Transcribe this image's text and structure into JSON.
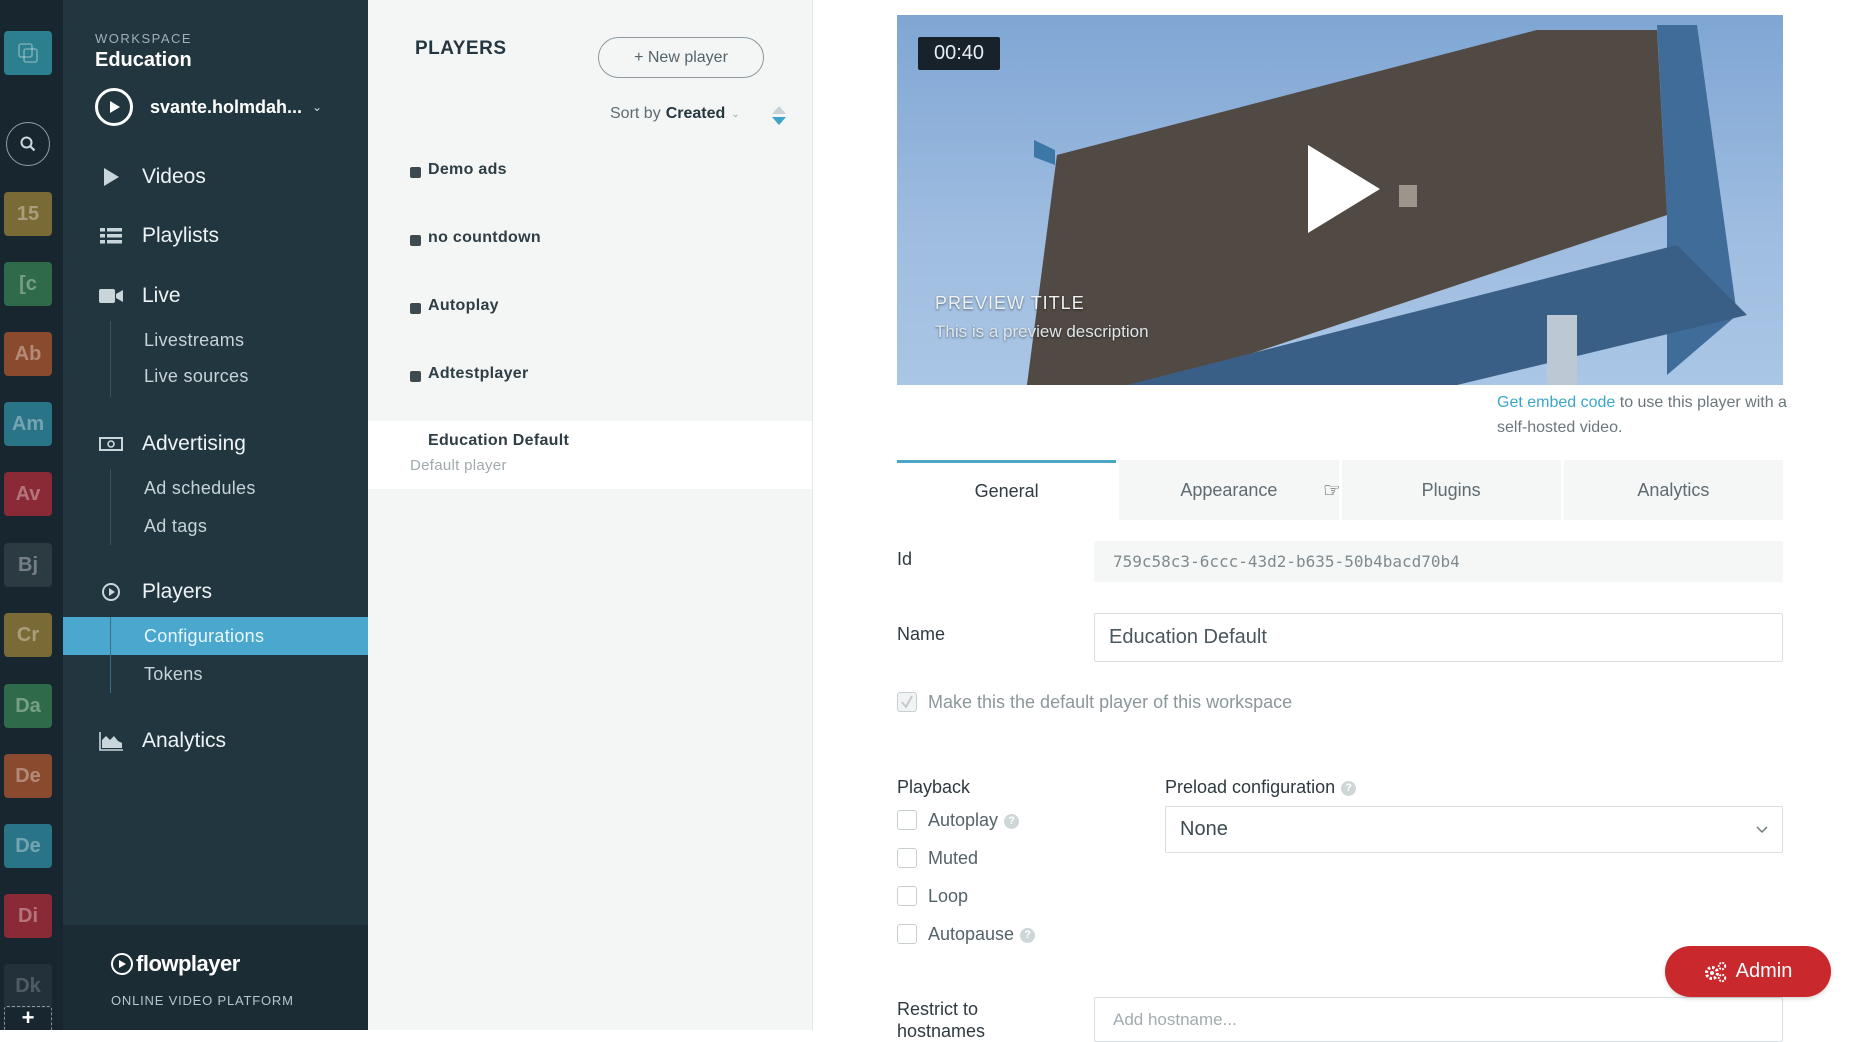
{
  "rail": {
    "tiles": [
      {
        "label": "",
        "icon": "workspaces-icon",
        "color": "#2b7f8e"
      },
      {
        "label": "15",
        "color": "#7a6a36"
      },
      {
        "label": "[c",
        "color": "#2f6b4a"
      },
      {
        "label": "Ab",
        "color": "#8a4a2e"
      },
      {
        "label": "Am",
        "color": "#2a7488"
      },
      {
        "label": "Av",
        "color": "#8a2a36"
      },
      {
        "label": "Bj",
        "color": "#2c3a42"
      },
      {
        "label": "Cr",
        "color": "#7a6a36"
      },
      {
        "label": "Da",
        "color": "#2f6b4a"
      },
      {
        "label": "De",
        "color": "#8a4a2e"
      },
      {
        "label": "De",
        "color": "#2a7488"
      },
      {
        "label": "Di",
        "color": "#8a2a36"
      },
      {
        "label": "Dk",
        "color": "#2c3a42"
      }
    ],
    "add_label": "+"
  },
  "sidebar": {
    "workspace_label": "WORKSPACE",
    "workspace_name": "Education",
    "account_name": "svante.holmdah...",
    "nav": [
      {
        "label": "Videos",
        "icon": "play-icon"
      },
      {
        "label": "Playlists",
        "icon": "list-icon"
      },
      {
        "label": "Live",
        "icon": "camera-icon",
        "children": [
          "Livestreams",
          "Live sources"
        ]
      },
      {
        "label": "Advertising",
        "icon": "money-icon",
        "children": [
          "Ad schedules",
          "Ad tags"
        ]
      },
      {
        "label": "Players",
        "icon": "play-circle-icon",
        "children": [
          "Configurations",
          "Tokens"
        ],
        "active_child": "Configurations"
      },
      {
        "label": "Analytics",
        "icon": "area-chart-icon"
      }
    ],
    "brand": "flowplayer",
    "tagline": "ONLINE VIDEO PLATFORM"
  },
  "players": {
    "title": "PLAYERS",
    "new_button": "+ New player",
    "sort_prefix": "Sort by",
    "sort_value": "Created",
    "items": [
      {
        "name": "Demo ads"
      },
      {
        "name": "no countdown"
      },
      {
        "name": "Autoplay"
      },
      {
        "name": "Adtestplayer"
      },
      {
        "name": "Education Default",
        "subtitle": "Default player",
        "selected": true
      }
    ]
  },
  "preview": {
    "duration": "00:40",
    "title": "PREVIEW TITLE",
    "description": "This is a preview description",
    "embed_link": "Get embed code",
    "embed_text": " to use this player with a self-hosted video."
  },
  "tabs": [
    {
      "label": "General",
      "active": true
    },
    {
      "label": "Appearance"
    },
    {
      "label": "Plugins"
    },
    {
      "label": "Analytics"
    }
  ],
  "form": {
    "id_label": "Id",
    "id_value": "759c58c3-6ccc-43d2-b635-50b4bacd70b4",
    "name_label": "Name",
    "name_value": "Education Default",
    "default_label": "Make this the default player of this workspace",
    "default_checked": true,
    "playback_label": "Playback",
    "playback_options": [
      {
        "label": "Autoplay",
        "help": true,
        "checked": false
      },
      {
        "label": "Muted",
        "help": false,
        "checked": false
      },
      {
        "label": "Loop",
        "help": false,
        "checked": false
      },
      {
        "label": "Autopause",
        "help": true,
        "checked": false
      }
    ],
    "preload_label": "Preload configuration",
    "preload_value": "None",
    "restrict_label": "Restrict to hostnames",
    "hostname_placeholder": "Add hostname..."
  },
  "admin_button": "Admin",
  "colors": {
    "accent": "#4aa8cf",
    "admin": "#c9282d",
    "sidebar": "#22363f",
    "rail": "#17262f"
  }
}
